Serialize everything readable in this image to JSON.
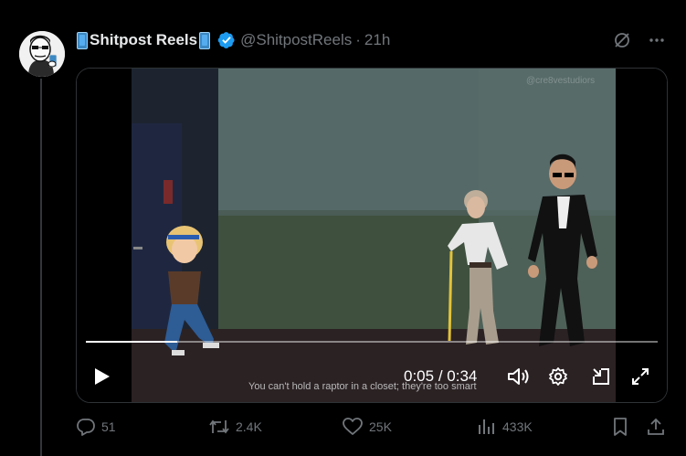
{
  "post": {
    "author_name": "Shitpost Reels",
    "handle": "@ShitpostReels",
    "separator": "·",
    "time_ago": "21h"
  },
  "video": {
    "watermark": "@cre8vestudiors",
    "current_time": "0:05",
    "time_sep": "/",
    "duration": "0:34",
    "progress": 0.16,
    "caption": "You can't hold a raptor in a closet; they're too smart"
  },
  "actions": {
    "replies": "51",
    "reposts": "2.4K",
    "likes": "25K",
    "views": "433K"
  },
  "icons": {
    "verified": "verified-badge-icon",
    "grok": "grok-icon",
    "more": "more-icon",
    "play": "play-icon",
    "volume": "volume-icon",
    "settings": "gear-icon",
    "pip": "picture-in-picture-icon",
    "fullscreen": "fullscreen-icon",
    "reply": "reply-icon",
    "repost": "repost-icon",
    "like": "heart-icon",
    "views": "views-icon",
    "bookmark": "bookmark-icon",
    "share": "share-icon"
  },
  "colors": {
    "background": "#000000",
    "text": "#e7e9ea",
    "muted": "#71767b",
    "verified": "#1d9bf0"
  }
}
